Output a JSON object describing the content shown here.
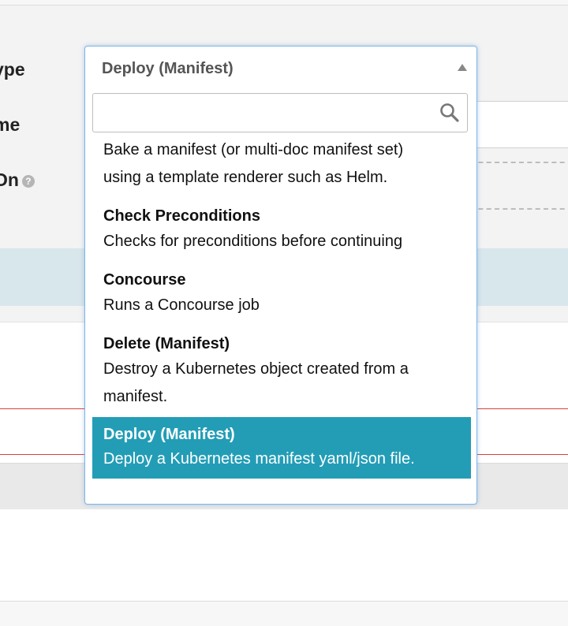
{
  "form": {
    "type_label": "ype",
    "name_label": "me",
    "depends_label": "On"
  },
  "dropdown": {
    "selected": "Deploy (Manifest)",
    "search_placeholder": "",
    "options": [
      {
        "title": "",
        "description_lines": [
          "Bake a manifest (or multi-doc manifest set)",
          "using a template renderer such as Helm."
        ]
      },
      {
        "title": "Check Preconditions",
        "description_lines": [
          "Checks for preconditions before continuing"
        ]
      },
      {
        "title": "Concourse",
        "description_lines": [
          "Runs a Concourse job"
        ]
      },
      {
        "title": "Delete (Manifest)",
        "description_lines": [
          "Destroy a Kubernetes object created from a",
          "manifest."
        ]
      },
      {
        "title": "Deploy (Manifest)",
        "description_lines": [
          "Deploy a Kubernetes manifest yaml/json file."
        ]
      }
    ]
  },
  "colors": {
    "highlight": "#239db6",
    "dropdown_border": "#7fb5e4"
  }
}
